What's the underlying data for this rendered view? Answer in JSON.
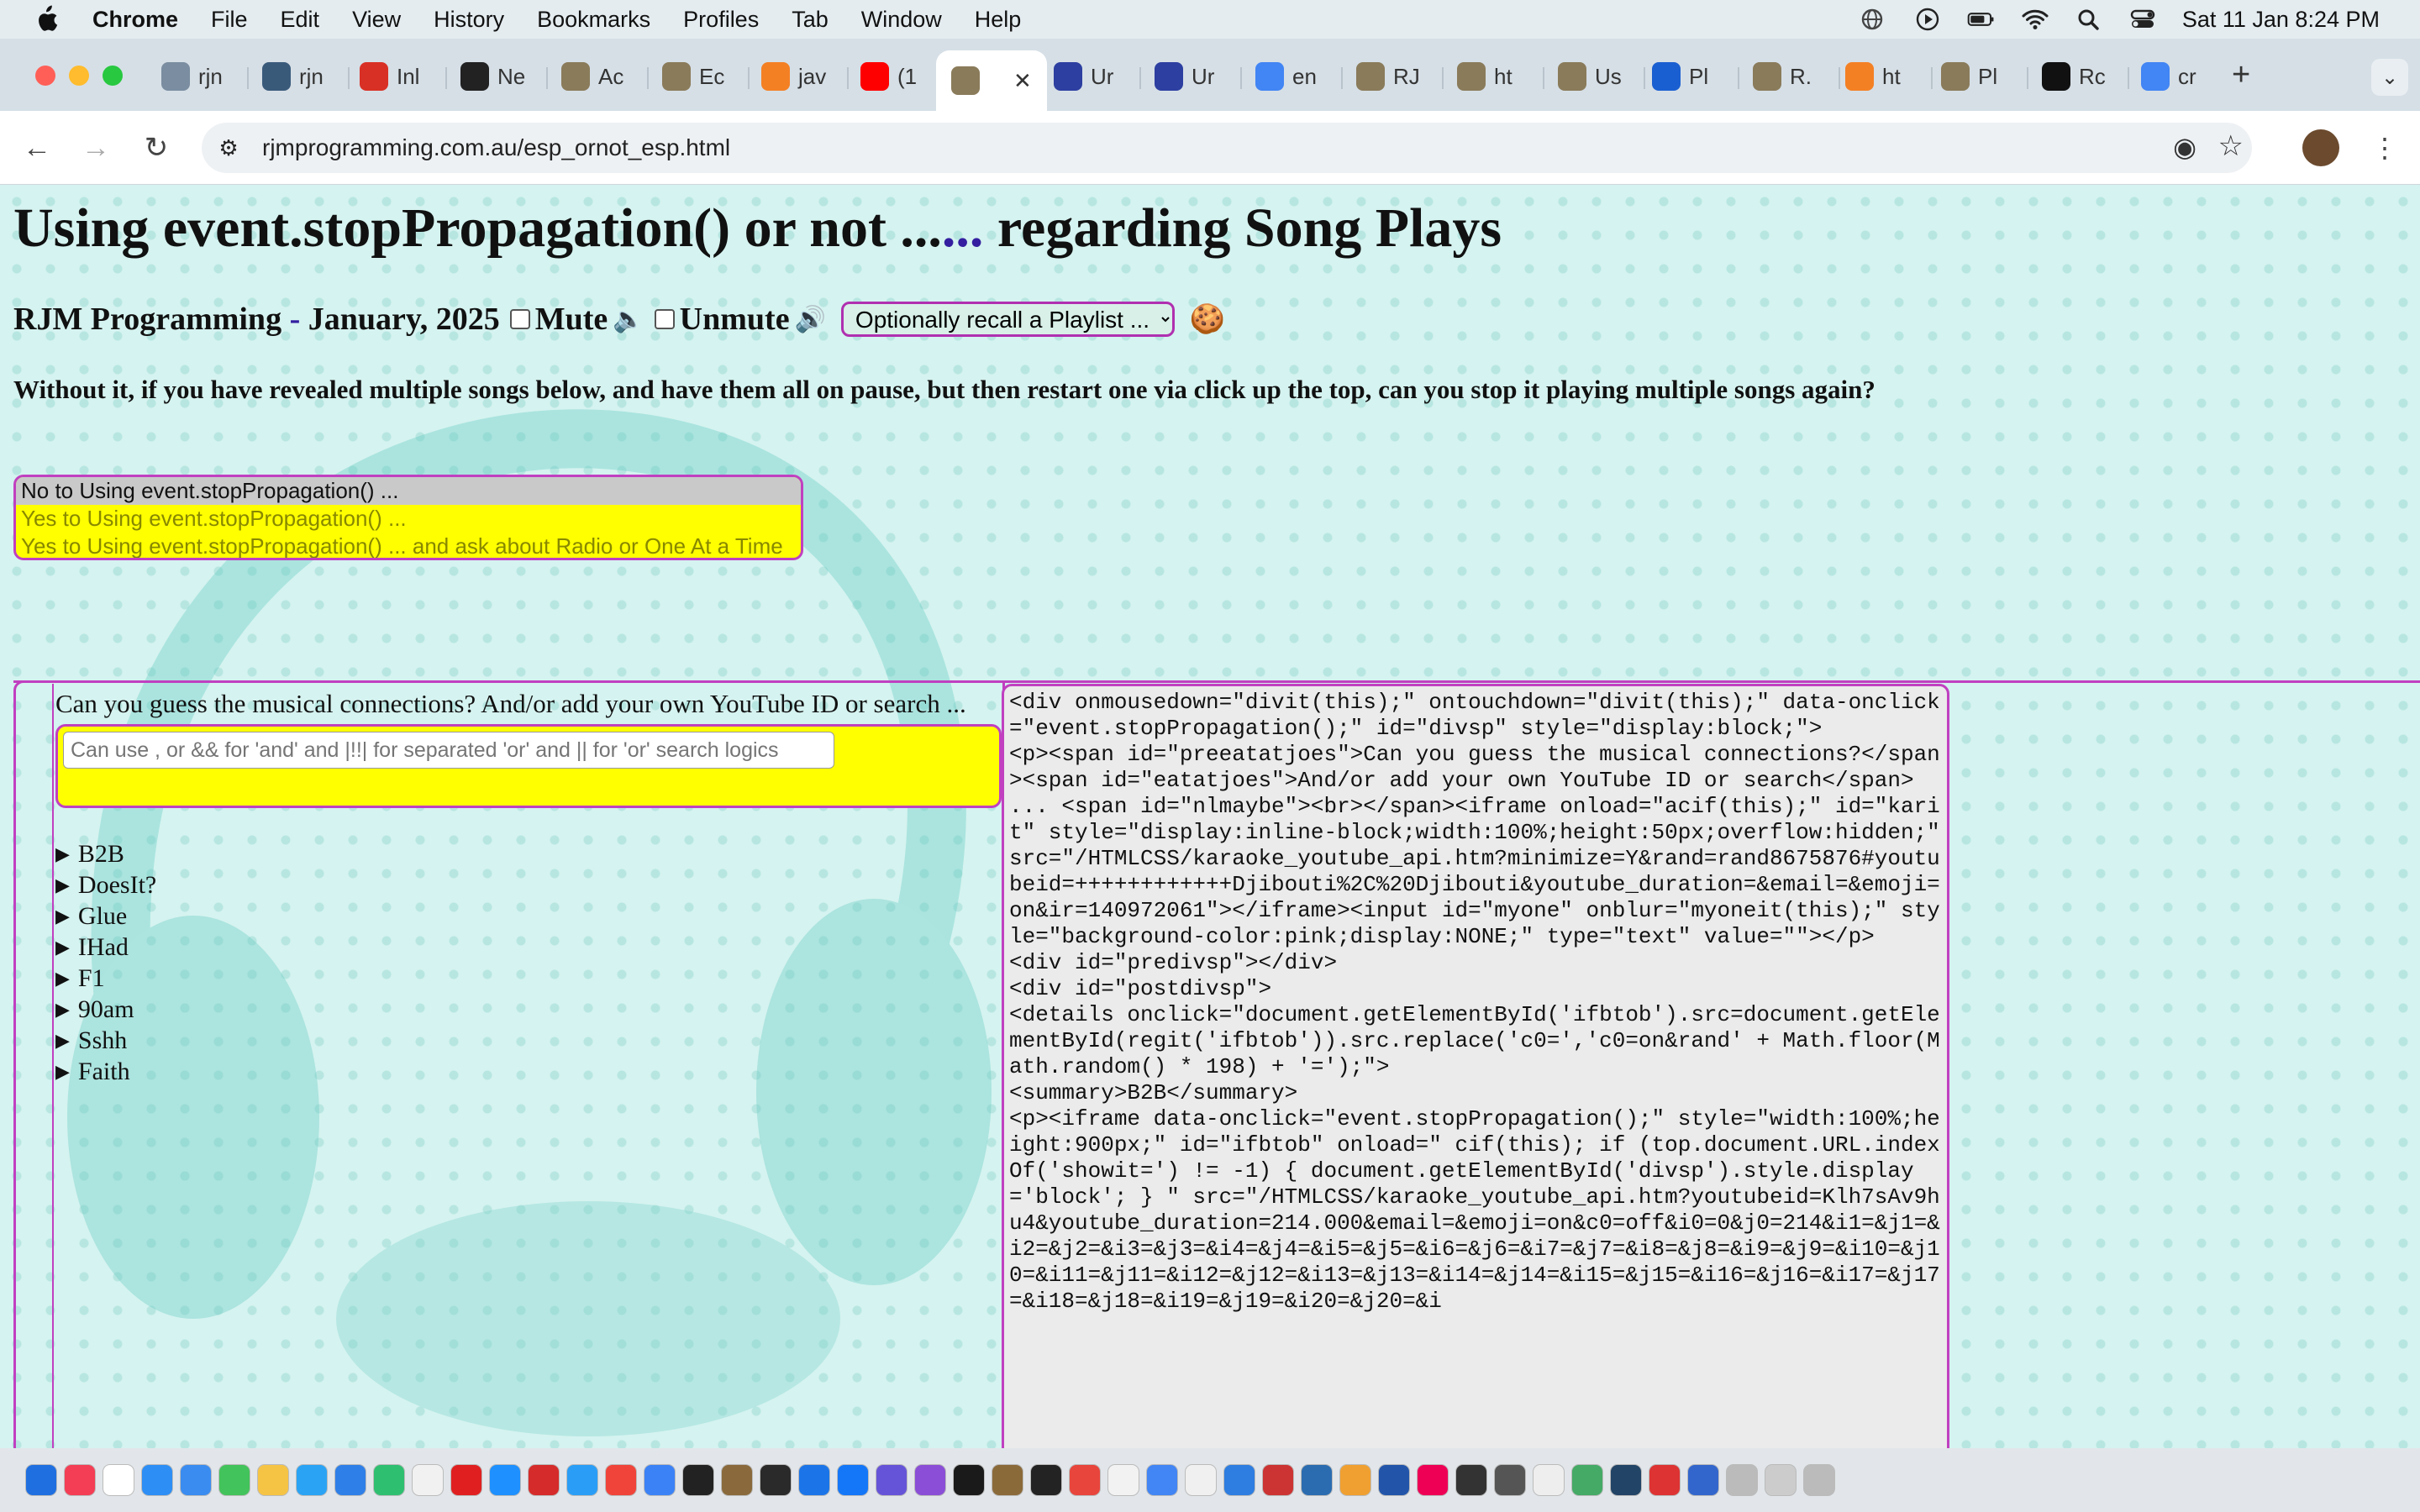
{
  "menubar": {
    "app_name": "Chrome",
    "items": [
      "File",
      "Edit",
      "View",
      "History",
      "Bookmarks",
      "Profiles",
      "Tab",
      "Window",
      "Help"
    ],
    "clock": "Sat 11 Jan  8:24 PM"
  },
  "tabs": [
    {
      "title": "rjn",
      "fav": "gauge-icon",
      "color": "#7b8da0"
    },
    {
      "title": "rjn",
      "fav": "gauge-icon",
      "color": "#3a5a7a"
    },
    {
      "title": "Inl",
      "fav": "gmail-icon",
      "color": "#d93025"
    },
    {
      "title": "Ne",
      "fav": "github-icon",
      "color": "#222222"
    },
    {
      "title": "Ac",
      "fav": "rjm-icon",
      "color": "#8a7b5a"
    },
    {
      "title": "Ec",
      "fav": "rjm-icon",
      "color": "#8a7b5a"
    },
    {
      "title": "jav",
      "fav": "stackoverflow-icon",
      "color": "#f48024"
    },
    {
      "title": "(1",
      "fav": "youtube-icon",
      "color": "#ff0000"
    },
    {
      "title": "",
      "fav": "rjm-icon",
      "color": "#8a7b5a"
    },
    {
      "title": "Ur",
      "fav": "info-icon",
      "color": "#2d3fa0"
    },
    {
      "title": "Ur",
      "fav": "info-icon",
      "color": "#2d3fa0"
    },
    {
      "title": "en",
      "fav": "google-icon",
      "color": "#4285f4"
    },
    {
      "title": "RJ",
      "fav": "rjm-icon",
      "color": "#8a7b5a"
    },
    {
      "title": "ht",
      "fav": "rjm-icon",
      "color": "#8a7b5a"
    },
    {
      "title": "Us",
      "fav": "rjm-icon",
      "color": "#8a7b5a"
    },
    {
      "title": "Pl",
      "fav": "forms-icon",
      "color": "#1a5fd1"
    },
    {
      "title": "R.",
      "fav": "rjm-icon",
      "color": "#8a7b5a"
    },
    {
      "title": "ht",
      "fav": "stackoverflow-icon",
      "color": "#f48024"
    },
    {
      "title": "Pl",
      "fav": "rjm-icon",
      "color": "#8a7b5a"
    },
    {
      "title": "Rc",
      "fav": "o-icon",
      "color": "#111111"
    },
    {
      "title": "cr",
      "fav": "google-icon",
      "color": "#4285f4"
    }
  ],
  "url": "rjmprogramming.com.au/esp_ornot_esp.html",
  "page": {
    "title": "Using event.stopPropagation() or not ...",
    "title_link": "...",
    "title_tail": " regarding Song Plays",
    "subhead": "RJM Programming",
    "subhead_link": "-",
    "subhead_date": "January, 2025",
    "mute_label": "Mute",
    "mute_icon": "🔈",
    "unmute_label": "Unmute",
    "unmute_icon": "🔊",
    "playlist_select": "Optionally recall a Playlist ...",
    "cookie_icon": "🍪",
    "question": "Without it, if you have revealed multiple songs below, and have them all on pause, but then restart one via click up the top, can you stop it playing multiple songs again?",
    "options": [
      "No to Using event.stopPropagation() ...",
      "Yes to Using event.stopPropagation() ...",
      "Yes to Using event.stopPropagation() ... and ask about Radio or One At a Time"
    ],
    "left_heading": "Can you guess the musical connections? And/or add your own YouTube ID or search ...",
    "search_placeholder": "Can use , or && for 'and' and |!!| for separated 'or' and || for 'or' search logics",
    "songs": [
      "B2B",
      "DoesIt?",
      "Glue",
      "IHad",
      "F1",
      "90am",
      "Sshh",
      "Faith"
    ],
    "code": "<div onmousedown=\"divit(this);\" ontouchdown=\"divit(this);\" data-onclick=\"event.stopPropagation();\" id=\"divsp\" style=\"display:block;\">\n<p><span id=\"preeatatjoes\">Can you guess the musical connections?</span><span id=\"eatatjoes\">And/or add your own YouTube ID or search</span> ... <span id=\"nlmaybe\"><br></span><iframe onload=\"acif(this);\" id=\"karit\" style=\"display:inline-block;width:100%;height:50px;overflow:hidden;\" src=\"/HTMLCSS/karaoke_youtube_api.htm?minimize=Y&rand=rand8675876#youtubeid=++++++++++++Djibouti%2C%20Djibouti&youtube_duration=&email=&emoji=on&ir=140972061\"></iframe><input id=\"myone\" onblur=\"myoneit(this);\" style=\"background-color:pink;display:NONE;\" type=\"text\" value=\"\"></p>\n<div id=\"predivsp\"></div>\n<div id=\"postdivsp\">\n<details onclick=\"document.getElementById('ifbtob').src=document.getElementById(regit('ifbtob')).src.replace('c0=','c0=on&rand' + Math.floor(Math.random() * 198) + '=');\">\n<summary>B2B</summary>\n<p><iframe data-onclick=\"event.stopPropagation();\" style=\"width:100%;height:900px;\" id=\"ifbtob\" onload=\" cif(this); if (top.document.URL.indexOf('showit=') != -1) { document.getElementById('divsp').style.display='block'; } \" src=\"/HTMLCSS/karaoke_youtube_api.htm?youtubeid=Klh7sAv9hu4&youtube_duration=214.000&email=&emoji=on&c0=off&i0=0&j0=214&i1=&j1=&i2=&j2=&i3=&j3=&i4=&j4=&i5=&j5=&i6=&j6=&i7=&j7=&i8=&j8=&i9=&j9=&i10=&j10=&i11=&j11=&i12=&j12=&i13=&j13=&i14=&j14=&i15=&j15=&i16=&j16=&i17=&j17=&i18=&j18=&i19=&j19=&i20=&j20=&i"
  },
  "colors": {
    "accent": "#c040c0",
    "highlight": "#ffff00",
    "page_bg": "#d5f3f0",
    "link": "#331fa0"
  }
}
